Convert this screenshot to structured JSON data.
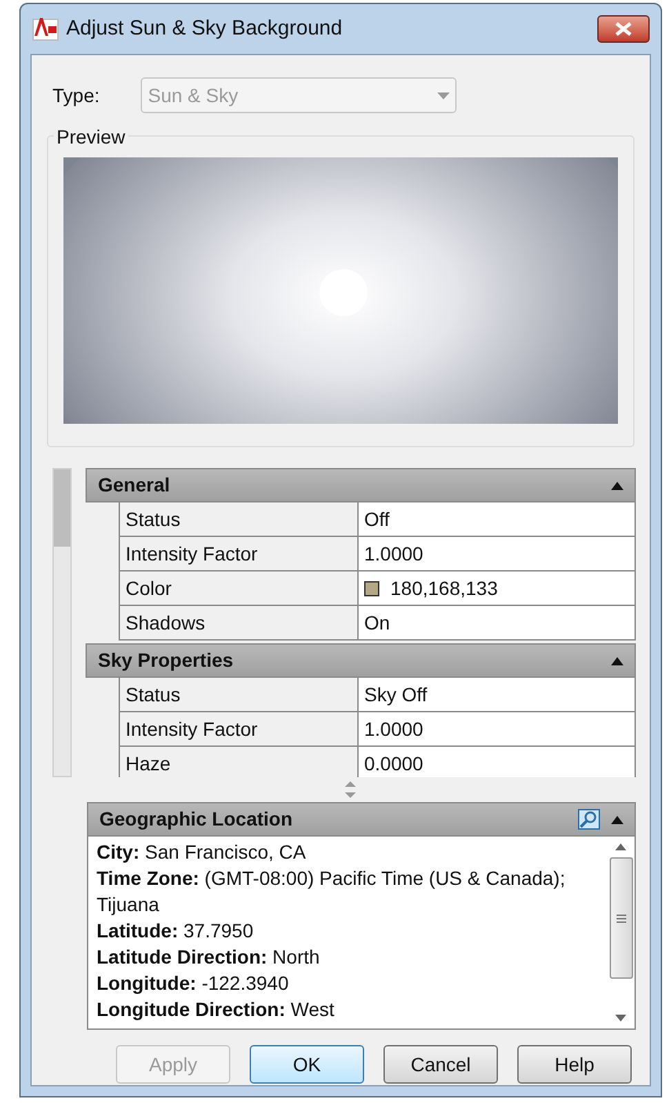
{
  "window": {
    "title": "Adjust Sun & Sky Background"
  },
  "type_field": {
    "label": "Type:",
    "value": "Sun & Sky",
    "disabled": true
  },
  "preview": {
    "label": "Preview",
    "kind": "picture"
  },
  "property_sections": [
    {
      "title": "General",
      "expanded": true,
      "rows": [
        {
          "name": "Status",
          "value": "Off",
          "kind": "text"
        },
        {
          "name": "Intensity Factor",
          "value": "1.0000",
          "kind": "text"
        },
        {
          "name": "Color",
          "value": "180,168,133",
          "kind": "color",
          "color": "#b4a885"
        },
        {
          "name": "Shadows",
          "value": "On",
          "kind": "text"
        }
      ]
    },
    {
      "title": "Sky Properties",
      "expanded": true,
      "rows": [
        {
          "name": "Status",
          "value": "Sky Off",
          "kind": "text"
        },
        {
          "name": "Intensity Factor",
          "value": "1.0000",
          "kind": "text"
        },
        {
          "name": "Haze",
          "value": "0.0000",
          "kind": "text"
        }
      ]
    }
  ],
  "geographic_location": {
    "title": "Geographic Location",
    "expanded": true,
    "lines": [
      "**City:** San Francisco, CA",
      "**Time Zone:** (GMT-08:00) Pacific Time (US & Canada); Tijuana",
      "**Latitude:** 37.7950",
      "**Latitude Direction:** North",
      "**Longitude:** -122.3940",
      "**Longitude Direction:** West"
    ]
  },
  "buttons": [
    {
      "label": "Apply",
      "disabled": true,
      "selected": false
    },
    {
      "label": "OK",
      "disabled": false,
      "selected": true
    },
    {
      "label": "Cancel",
      "disabled": false,
      "selected": false
    },
    {
      "label": "Help",
      "disabled": false,
      "selected": false
    }
  ]
}
